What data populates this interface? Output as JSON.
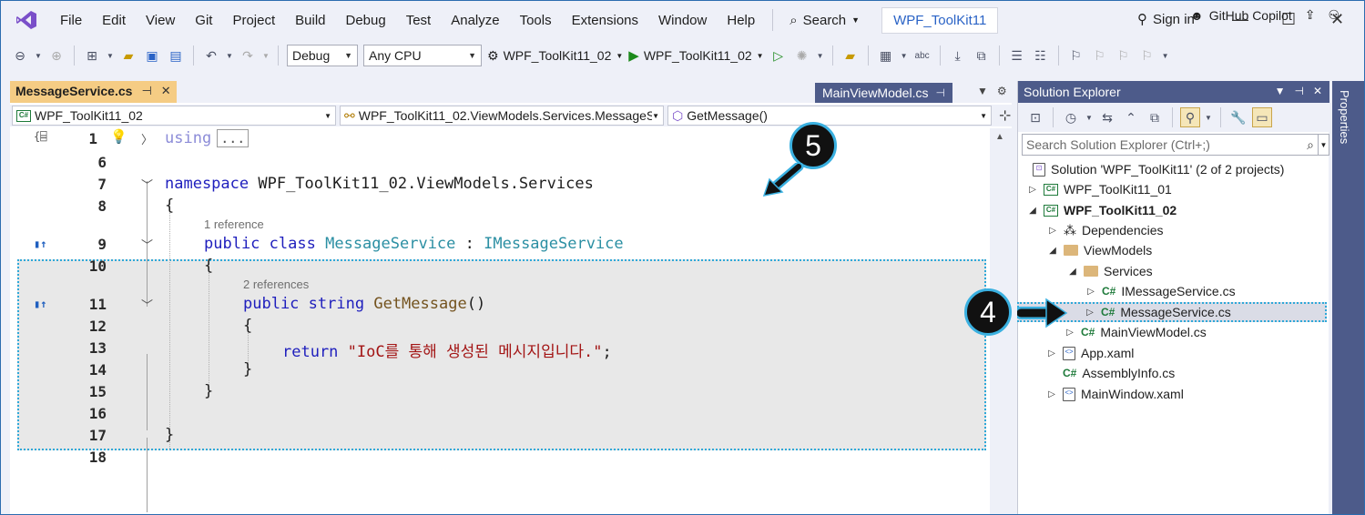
{
  "menu": {
    "items": [
      "File",
      "Edit",
      "View",
      "Git",
      "Project",
      "Build",
      "Debug",
      "Test",
      "Analyze",
      "Tools",
      "Extensions",
      "Window",
      "Help"
    ],
    "search_label": "Search",
    "solution_name": "WPF_ToolKit11",
    "signin_label": "Sign in"
  },
  "toolbar": {
    "config": "Debug",
    "platform": "Any CPU",
    "startup_project": "WPF_ToolKit11_02",
    "run_target": "WPF_ToolKit11_02",
    "copilot_label": "GitHub Copilot"
  },
  "editor": {
    "active_tab": "MessageService.cs",
    "inactive_tab": "MainViewModel.cs",
    "nav_project": "WPF_ToolKit11_02",
    "nav_type": "WPF_ToolKit11_02.ViewModels.Services.MessageSe",
    "nav_member": "GetMessage()",
    "lines": [
      {
        "n": "1"
      },
      {
        "n": "6"
      },
      {
        "n": "7"
      },
      {
        "n": "8"
      },
      {
        "n": "9"
      },
      {
        "n": "10"
      },
      {
        "n": "11"
      },
      {
        "n": "12"
      },
      {
        "n": "13"
      },
      {
        "n": "14"
      },
      {
        "n": "15"
      },
      {
        "n": "16"
      },
      {
        "n": "17"
      },
      {
        "n": "18"
      }
    ],
    "code": {
      "using_kw": "using",
      "collapsed": "...",
      "namespace_kw": "namespace",
      "namespace_name": " WPF_ToolKit11_02.ViewModels.Services",
      "open_brace": "{",
      "close_brace": "}",
      "class_ref_count": "1 reference",
      "public_kw": "public",
      "class_kw": "class",
      "class_name": "MessageService",
      "colon": " : ",
      "interface_name": "IMessageService",
      "method_ref_count": "2 references",
      "string_kw": "string",
      "method_name": "GetMessage",
      "parens": "()",
      "return_kw": "return",
      "return_value": "\"IoC를 통해 생성된 메시지입니다.\"",
      "semicolon": ";"
    }
  },
  "solution_explorer": {
    "title": "Solution Explorer",
    "search_placeholder": "Search Solution Explorer (Ctrl+;)",
    "solution_label": "Solution 'WPF_ToolKit11' (2 of 2 projects)",
    "project1": "WPF_ToolKit11_01",
    "project2": "WPF_ToolKit11_02",
    "dependencies": "Dependencies",
    "viewmodels": "ViewModels",
    "services": "Services",
    "imessageservice": "IMessageService.cs",
    "messageservice": "MessageService.cs",
    "mainviewmodel": "MainViewModel.cs",
    "appxaml": "App.xaml",
    "assemblyinfo": "AssemblyInfo.cs",
    "mainwindow": "MainWindow.xaml"
  },
  "properties_tab": "Properties",
  "callouts": {
    "step_code": "5",
    "step_tree": "4"
  },
  "colors": {
    "accent_tab": "#f5cc84",
    "panel_header": "#4d5b8a",
    "callout_ring": "#3ab0e0",
    "keyword": "#1f1fbd",
    "type": "#2b8fa3",
    "string": "#a31515"
  }
}
